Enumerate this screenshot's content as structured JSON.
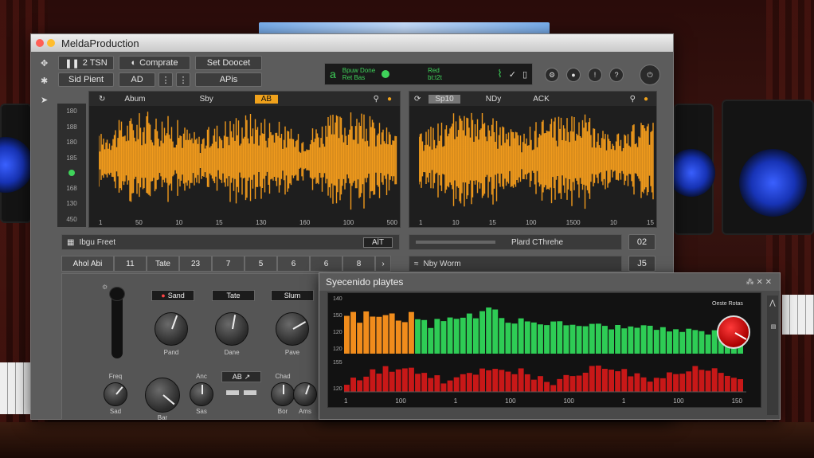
{
  "window": {
    "title": "MeldaProduction"
  },
  "toolbar": {
    "btn_2tsn": "2 TSN",
    "btn_compare": "Comprate",
    "btn_set_doocet": "Set Doocet",
    "btn_sid_pient": "Sid Pient",
    "btn_ad": "AD",
    "btn_apis": "APis"
  },
  "lcd": {
    "left_a": "a",
    "text1": "Bpuw Done",
    "text2": "Ret Bas",
    "text3": "Red",
    "text4": "bt:t2t"
  },
  "left_wave": {
    "h_abum": "Abum",
    "h_sby": "Sby",
    "h_ab": "AB",
    "y_labels": [
      "180",
      "188",
      "180",
      "185",
      "",
      "168",
      "130",
      "450"
    ],
    "x_ticks": [
      "1",
      "50",
      "10",
      "15",
      "130",
      "160",
      "100",
      "500"
    ]
  },
  "right_wave": {
    "h_sp": "Sp10",
    "h_ndy": "NDy",
    "h_ack": "ACK",
    "x_ticks": [
      "1",
      "10",
      "15",
      "100",
      "1500",
      "10",
      "15"
    ]
  },
  "strips": {
    "left_label": "Ibgu Freet",
    "left_btn": "AlT",
    "right_label": "Plard CThrehe",
    "right_btn": "02",
    "right2_label": "Nby Worm",
    "right2_btn": "J5"
  },
  "numrow": [
    "Ahol Abi",
    "11",
    "Tate",
    "23",
    "7",
    "5",
    "6",
    "6",
    "8",
    "›"
  ],
  "knobs": {
    "tag1": "Sand",
    "tag2": "Tate",
    "tag3": "Slum",
    "label1": "Pand",
    "label2": "Dane",
    "label3": "Pave",
    "ab_label": "AB",
    "small_labels": [
      "Freq",
      "Sad",
      "Bar",
      "Anc",
      "Sas",
      "Chad",
      "Bor",
      "Ams"
    ]
  },
  "spectrum": {
    "title": "Syecenido playtes",
    "y_top": [
      "140",
      "150",
      "120",
      "120"
    ],
    "y_bottom": [
      "155",
      "120"
    ],
    "x_ticks": [
      "1",
      "100",
      "1",
      "100",
      "100",
      "1",
      "100",
      "150"
    ],
    "red_knob_label": "Oeste Rotas"
  },
  "colors": {
    "waveform": "#f09a1c",
    "spectrum_orange": "#f08c1c",
    "spectrum_green": "#2ecc55",
    "spectrum_red": "#c81818",
    "accent_lcd": "#3fd35a"
  }
}
